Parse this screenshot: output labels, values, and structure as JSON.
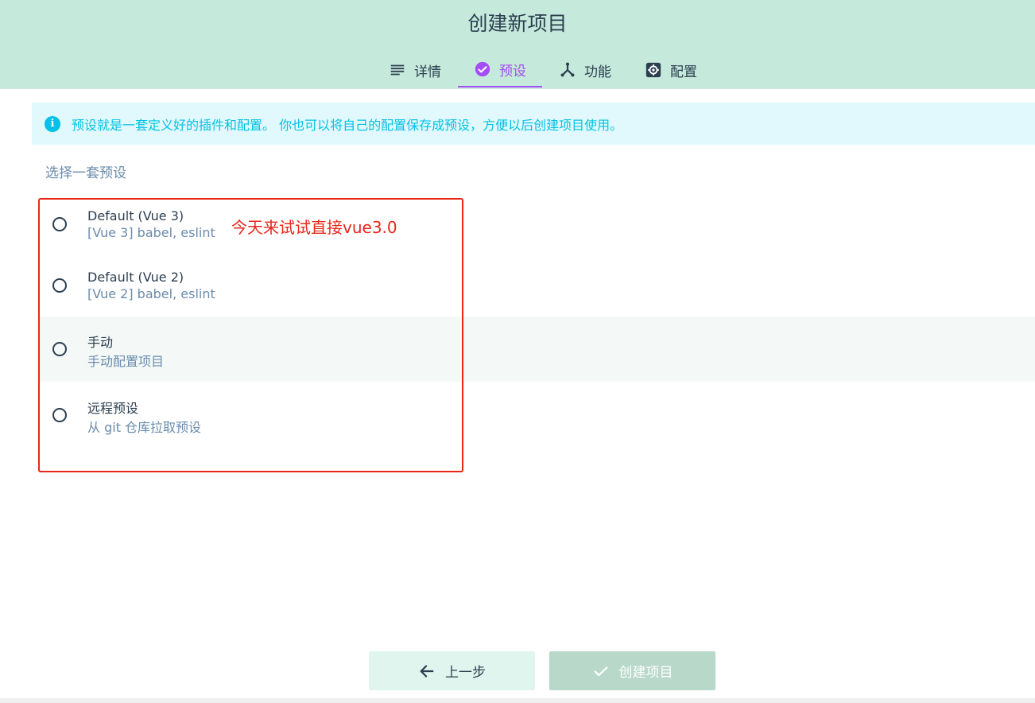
{
  "page_title": "创建新项目",
  "tabs": [
    {
      "label": "详情",
      "icon": "list-icon",
      "active": false
    },
    {
      "label": "预设",
      "icon": "check-circle-icon",
      "active": true
    },
    {
      "label": "功能",
      "icon": "fork-icon",
      "active": false
    },
    {
      "label": "配置",
      "icon": "gear-icon",
      "active": false
    }
  ],
  "info": {
    "icon_glyph": "i",
    "text": "预设就是一套定义好的插件和配置。 你也可以将自己的配置保存成预设，方便以后创建项目使用。"
  },
  "section_label": "选择一套预设",
  "presets": [
    {
      "name": "Default (Vue 3)",
      "description": "[Vue 3] babel, eslint"
    },
    {
      "name": "Default (Vue 2)",
      "description": "[Vue 2] babel, eslint"
    },
    {
      "name": "手动",
      "description": "手动配置项目"
    },
    {
      "name": "远程预设",
      "description": "从 git 仓库拉取预设"
    }
  ],
  "annotation": "今天来试试直接vue3.0",
  "buttons": {
    "prev_label": "上一步",
    "create_label": "创建项目"
  },
  "colors": {
    "header_bg": "#c5eadc",
    "accent": "#a44cf6",
    "info": "#03c2e6",
    "annotation_red": "#e8271b"
  }
}
